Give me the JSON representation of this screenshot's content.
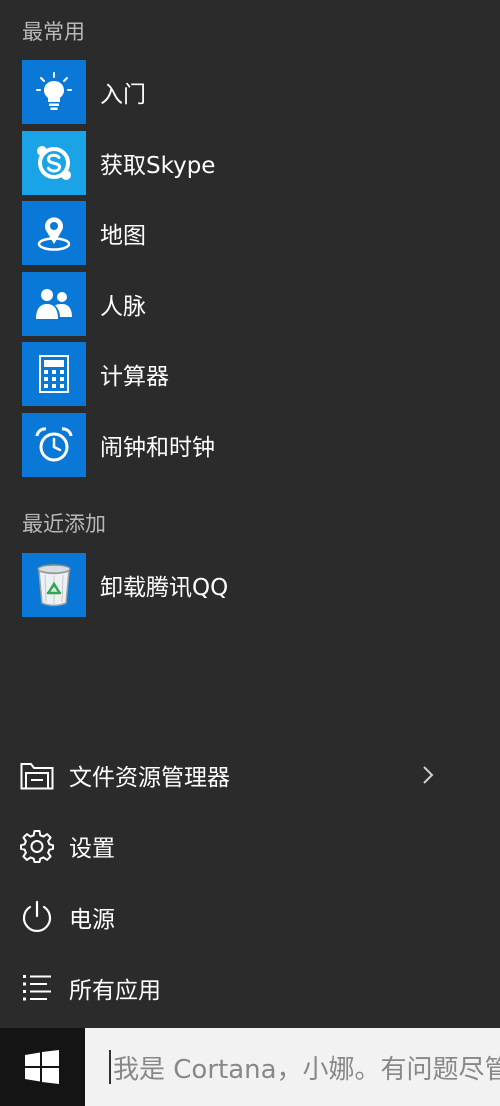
{
  "start_menu": {
    "most_used": {
      "header": "最常用",
      "items": [
        {
          "label": "入门",
          "icon": "lightbulb-icon"
        },
        {
          "label": "获取Skype",
          "icon": "skype-icon"
        },
        {
          "label": "地图",
          "icon": "map-pin-icon"
        },
        {
          "label": "人脉",
          "icon": "people-icon"
        },
        {
          "label": "计算器",
          "icon": "calculator-icon"
        },
        {
          "label": "闹钟和时钟",
          "icon": "alarm-clock-icon"
        }
      ]
    },
    "recently_added": {
      "header": "最近添加",
      "items": [
        {
          "label": "卸载腾讯QQ",
          "icon": "recycle-bin-icon"
        }
      ]
    },
    "system_items": [
      {
        "label": "文件资源管理器",
        "icon": "folder-icon",
        "has_submenu": true
      },
      {
        "label": "设置",
        "icon": "gear-icon"
      },
      {
        "label": "电源",
        "icon": "power-icon"
      },
      {
        "label": "所有应用",
        "icon": "list-icon"
      }
    ]
  },
  "taskbar": {
    "search_placeholder": "我是 Cortana，小娜。有问题尽管问我"
  },
  "colors": {
    "menu_bg": "#2b2b2b",
    "tile_blue": "#0a78d7",
    "skype_blue": "#1aa3e6",
    "taskbar_bg": "#141414",
    "search_bg": "#f2f2f2"
  }
}
